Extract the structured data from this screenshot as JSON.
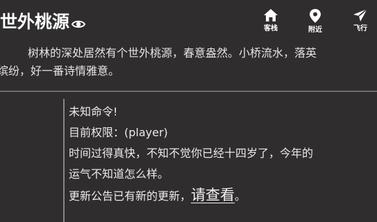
{
  "header": {
    "title": "世外桃源",
    "title_icon": "eye-icon",
    "nav": [
      {
        "label": "客栈",
        "icon": "home-icon"
      },
      {
        "label": "附近",
        "icon": "location-pin-icon"
      },
      {
        "label": "飞行",
        "icon": "paper-plane-icon"
      }
    ]
  },
  "description": {
    "line1": "树林的深处居然有个世外桃源，春意盎然。小桥流水，落英",
    "line2": "缤纷，好一番诗情雅意。"
  },
  "console": {
    "line1": "未知命令!",
    "line2": "目前权限：(player)",
    "line3": "时间过得真快，不知不觉你已经十四岁了，今年的",
    "line4": "运气不知道怎么样。",
    "line5_prefix": "更新公告已有新的更新，",
    "line5_link": "请查看",
    "line5_suffix": "。"
  },
  "colors": {
    "background": "#2f2d2d",
    "text": "#f0eeee",
    "divider": "#6f6b6b"
  }
}
